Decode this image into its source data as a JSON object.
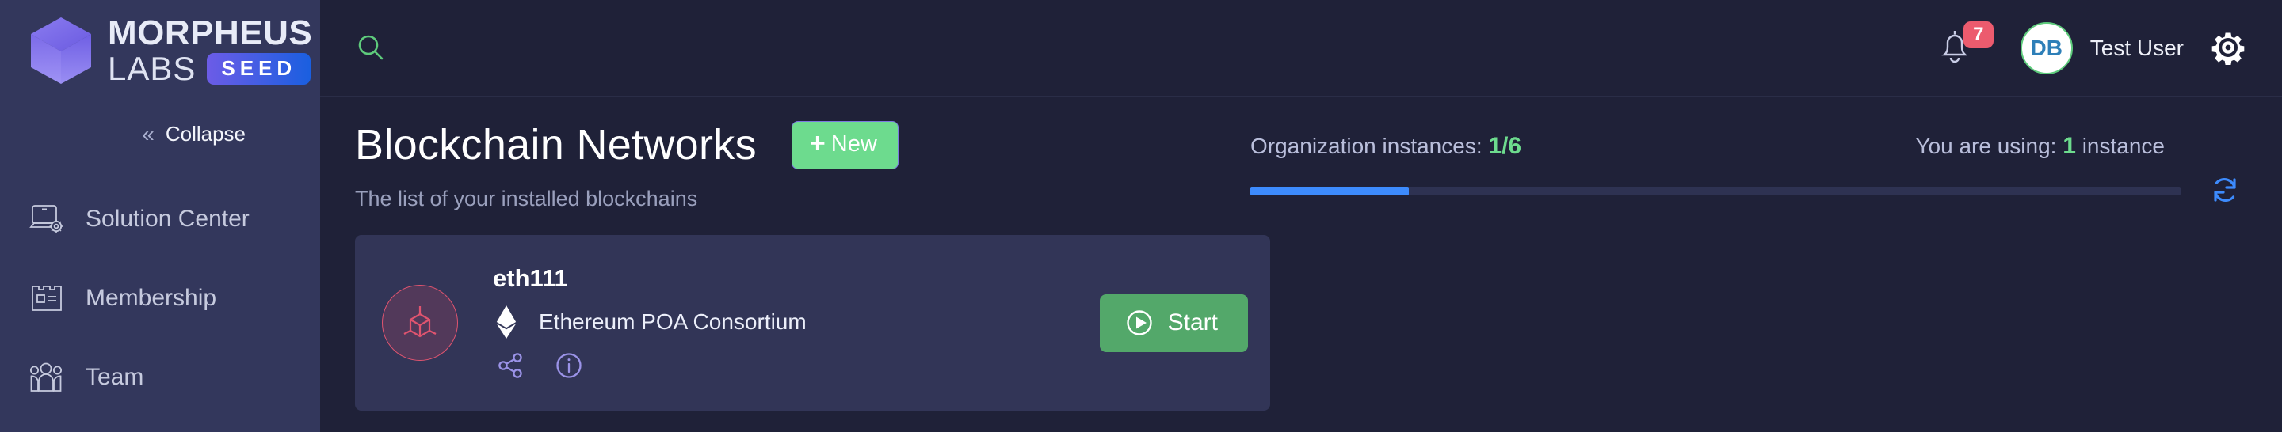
{
  "brand": {
    "name_top": "MORPHEUS",
    "name_bottom": "LABS",
    "badge": "SEED"
  },
  "sidebar": {
    "collapse_label": "Collapse",
    "collapse_icon": "chevron-double-left-icon",
    "items": [
      {
        "label": "Solution Center",
        "icon": "laptop-gear-icon"
      },
      {
        "label": "Membership",
        "icon": "membership-card-icon"
      },
      {
        "label": "Team",
        "icon": "people-group-icon"
      }
    ]
  },
  "topbar": {
    "search_icon": "search-icon",
    "notifications_icon": "bell-icon",
    "notifications_count": "7",
    "avatar_initials": "DB",
    "username": "Test User",
    "settings_icon": "gear-icon"
  },
  "page": {
    "title": "Blockchain Networks",
    "new_button": "New",
    "new_button_plus": "+",
    "subtitle": "The list of your installed blockchains"
  },
  "usage": {
    "org_label": "Organization instances:",
    "org_value": "1/6",
    "using_label": "You are using:",
    "using_value": "1",
    "using_suffix": "instance",
    "progress_percent": 17,
    "refresh_icon": "refresh-icon"
  },
  "networks": [
    {
      "name": "eth111",
      "type": "Ethereum POA Consortium",
      "type_icon": "ethereum-icon",
      "badge_icon": "cube-node-icon",
      "share_icon": "share-icon",
      "info_icon": "info-icon",
      "action_label": "Start",
      "action_icon": "play-circle-icon"
    }
  ],
  "colors": {
    "accent_green": "#6ddb8e",
    "accent_blue": "#3d8bfd",
    "badge_red": "#ec5b6e",
    "sidebar_bg": "#33375c",
    "main_bg": "#1f2138",
    "card_bg": "#323557",
    "network_badge": "#e0546f"
  }
}
